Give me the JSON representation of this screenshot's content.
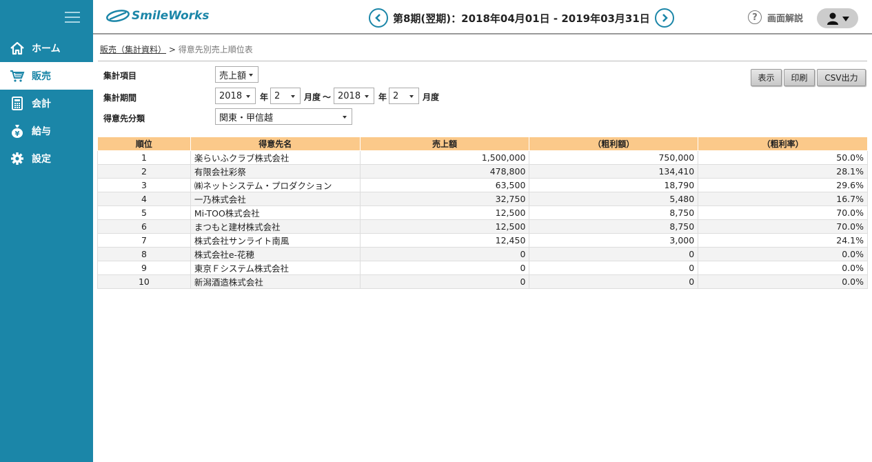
{
  "header": {
    "logo_text": "SmileWorks",
    "period": "第8期(翌期)：2018年04月01日 - 2019年03月31日",
    "help_label": "画面解説"
  },
  "sidebar": {
    "items": [
      {
        "label": "ホーム",
        "icon": "home-icon"
      },
      {
        "label": "販売",
        "icon": "cart-icon"
      },
      {
        "label": "会計",
        "icon": "calculator-icon"
      },
      {
        "label": "給与",
        "icon": "money-bag-icon"
      },
      {
        "label": "設定",
        "icon": "gear-icon"
      }
    ],
    "active": "販売"
  },
  "breadcrumb": {
    "parent": "販売（集計資料）",
    "separator": ">",
    "current": "得意先別売上順位表"
  },
  "form": {
    "item_label": "集計項目",
    "item_value": "売上額",
    "period_label": "集計期間",
    "from_year": "2018",
    "year_unit": "年",
    "from_month": "2",
    "month_unit": "月度",
    "tilde": "〜",
    "to_year": "2018",
    "to_month": "2",
    "category_label": "得意先分類",
    "category_value": "関東・甲信越"
  },
  "buttons": {
    "show": "表示",
    "print": "印刷",
    "csv": "CSV出力"
  },
  "table": {
    "headers": [
      "順位",
      "得意先名",
      "売上額",
      "（粗利額）",
      "（粗利率）"
    ],
    "rows": [
      [
        "1",
        "楽らいふクラブ株式会社",
        "1,500,000",
        "750,000",
        "50.0%"
      ],
      [
        "2",
        "有限会社彩祭",
        "478,800",
        "134,410",
        "28.1%"
      ],
      [
        "3",
        "㈱ネットシステム・プロダクション",
        "63,500",
        "18,790",
        "29.6%"
      ],
      [
        "4",
        "一乃株式会社",
        "32,750",
        "5,480",
        "16.7%"
      ],
      [
        "5",
        "Mi-TOO株式会社",
        "12,500",
        "8,750",
        "70.0%"
      ],
      [
        "6",
        "まつもと建材株式会社",
        "12,500",
        "8,750",
        "70.0%"
      ],
      [
        "7",
        "株式会社サンライト南風",
        "12,450",
        "3,000",
        "24.1%"
      ],
      [
        "8",
        "株式会社e-花穂",
        "0",
        "0",
        "0.0%"
      ],
      [
        "9",
        "東京Ｆシステム株式会社",
        "0",
        "0",
        "0.0%"
      ],
      [
        "10",
        "新潟酒造株式会社",
        "0",
        "0",
        "0.0%"
      ]
    ]
  },
  "colors": {
    "sidebar": "#1b86a8",
    "table_header": "#fbc98a",
    "accent": "#1b86a8"
  }
}
